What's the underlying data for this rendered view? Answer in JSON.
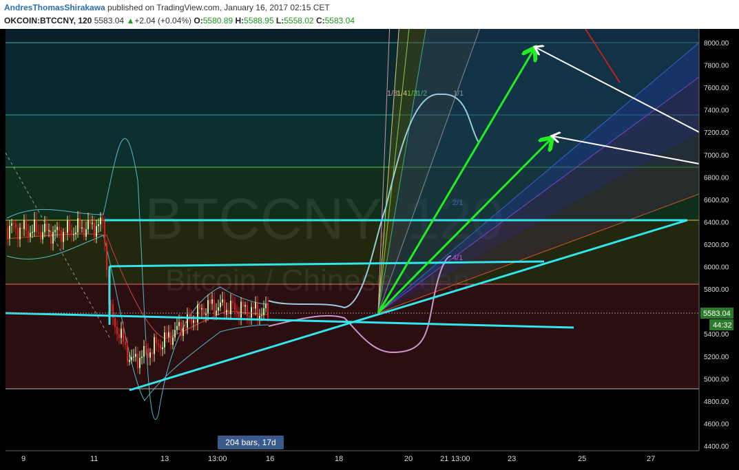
{
  "header": {
    "author": "AndresThomasShirakawa",
    "published": " published on TradingView.com, January 16, 2017 02:15 CET",
    "symbol": "OKCOIN:BTCCNY, 120",
    "last": "5583.04",
    "change": "+2.04 (+0.04%)",
    "o_label": "O:",
    "o_value": "5580.89",
    "h_label": "H:",
    "h_value": "5588.95",
    "l_label": "L:",
    "l_value": "5558.02",
    "c_label": "C:",
    "c_value": "5583.04"
  },
  "watermark": {
    "symbol": "BTCCNY, 120",
    "name": "Bitcoin / Chinese Yuan"
  },
  "bars_badge": "204 bars, 17d",
  "price_tag": "5583.04",
  "countdown_tag": "44:32",
  "colors": {
    "background": "#000000",
    "cyan_lines": "#33e6ee",
    "green_arrows": "#22ee22",
    "white_arrows": "#ffffff",
    "bearish_candle": "#e02020",
    "bullish_candle": "#c8f0a0"
  },
  "chart_data": {
    "type": "candlestick",
    "title": "OKCOIN:BTCCNY, 120",
    "y_ticks": [
      8000,
      7800,
      7600,
      7400,
      7200,
      7000,
      6800,
      6600,
      6400,
      6200,
      6000,
      5800,
      5600,
      5400,
      5200,
      5000,
      4800,
      4600,
      4400
    ],
    "ylim": [
      4350,
      8150
    ],
    "x_ticks": [
      "9",
      "11",
      "13",
      "13:00",
      "16",
      "18",
      "20",
      "21",
      "13:00",
      "23",
      "25",
      "27"
    ],
    "fib_levels": [
      8020,
      7950,
      7350,
      6890,
      6420,
      5840,
      4900
    ],
    "fan_labels": [
      "1/8",
      "1/4",
      "1/3",
      "1/2",
      "1/1",
      "2/1",
      "4/1",
      "8/1"
    ],
    "price_series_approx": [
      {
        "date": "Jan 9",
        "close": 6350
      },
      {
        "date": "Jan 10",
        "close": 6300
      },
      {
        "date": "Jan 11",
        "close": 6380
      },
      {
        "date": "Jan 11 late",
        "close": 5600
      },
      {
        "date": "Jan 12",
        "close": 5150
      },
      {
        "date": "Jan 13",
        "close": 5350
      },
      {
        "date": "Jan 14",
        "close": 5650
      },
      {
        "date": "Jan 15",
        "close": 5620
      },
      {
        "date": "Jan 16",
        "close": 5583.04
      }
    ]
  }
}
